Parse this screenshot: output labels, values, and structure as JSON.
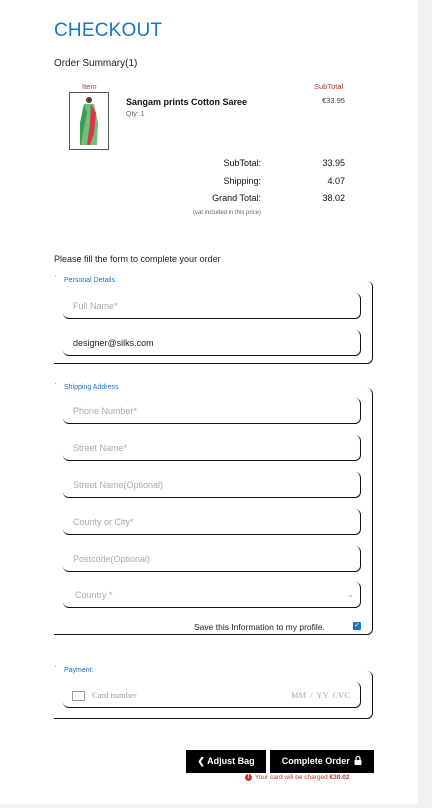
{
  "page": {
    "title": "CHECKOUT"
  },
  "summary": {
    "heading": "Order Summary(1)",
    "col_item": "Item",
    "col_subtotal": "SubTotal",
    "item": {
      "name": "Sangam prints Cotton Saree",
      "qty": "Qty: 1",
      "price": "€33.95"
    },
    "totals": [
      {
        "label": "SubTotal:",
        "value": "33.95"
      },
      {
        "label": "Shipping:",
        "value": "4.07"
      },
      {
        "label": "Grand Total:",
        "value": "38.02"
      }
    ],
    "vat_note": "(vat included in this price)"
  },
  "form": {
    "intro": "Please fill the form to complete your order",
    "personal": {
      "legend": "Personal Details",
      "full_name_placeholder": "Full Name*",
      "email_value": "designer@silks.com"
    },
    "shipping": {
      "legend": "Shipping Address",
      "phone_placeholder": "Phone Number*",
      "street_placeholder": "Street Name*",
      "street2_placeholder": "Street Name(Optional)",
      "county_placeholder": "County or City*",
      "postcode_placeholder": "Postcode(Optional)",
      "country_selected": "Country *",
      "save_label": "Save this Information to my profile."
    },
    "payment": {
      "legend": "Payment:",
      "card_placeholder": "Card number",
      "exp_placeholder": "MM / YY  CVC"
    }
  },
  "actions": {
    "adjust_label": "Adjust Bag",
    "complete_label": "Complete Order",
    "charge_note_prefix": "Your card will be charged",
    "charge_amount": "€38.02"
  },
  "colors": {
    "accent": "#1a73c9",
    "alert": "#c0392b",
    "button": "#000000"
  },
  "icons": {
    "back": "chevron-left-icon",
    "lock": "lock-icon",
    "alert": "exclamation-circle-icon",
    "card": "credit-card-icon",
    "check": "checkmark-icon"
  }
}
